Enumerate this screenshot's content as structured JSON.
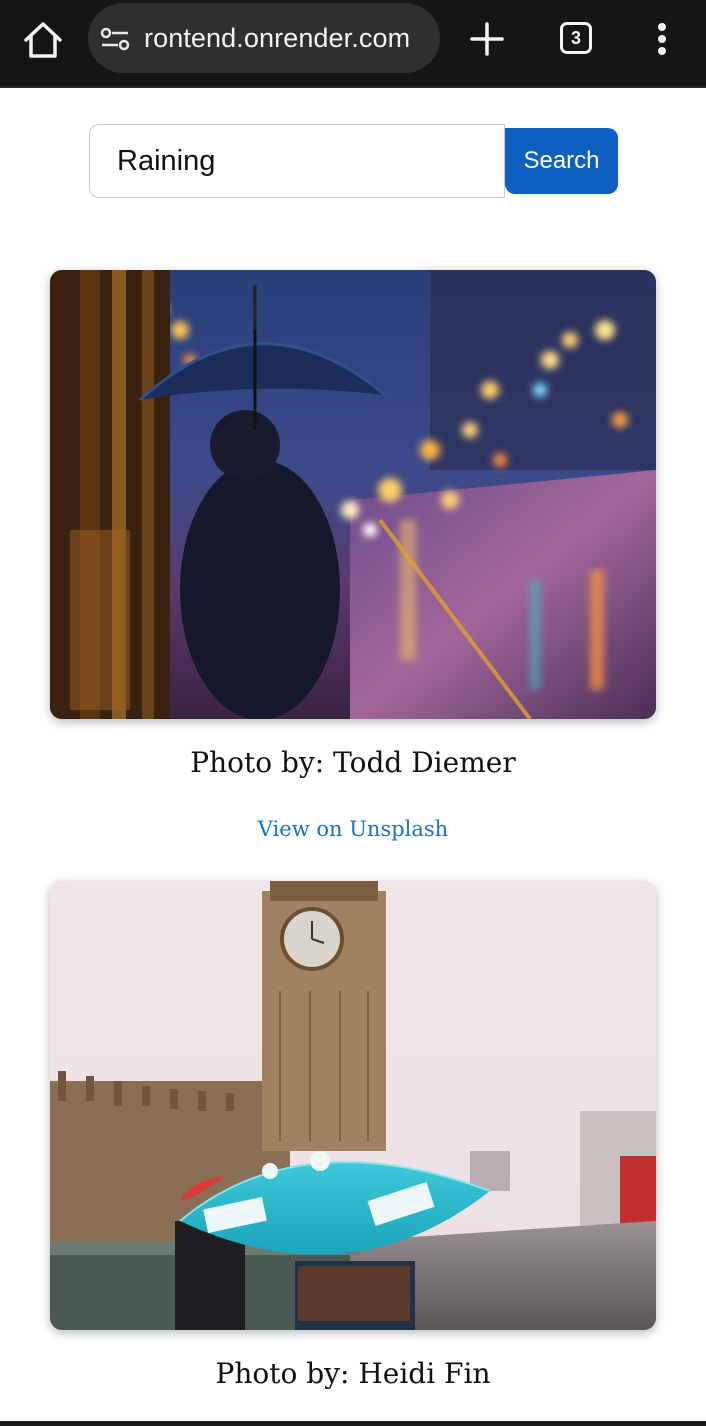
{
  "browser": {
    "url": "rontend.onrender.com",
    "tab_count": "3",
    "icons": [
      "home-icon",
      "tune-icon",
      "plus-icon",
      "tab-switcher-icon",
      "more-vert-icon"
    ]
  },
  "search": {
    "value": "Raining",
    "button_label": "Search",
    "accent": "#0d5fc0"
  },
  "results": [
    {
      "credit": "Photo by: Todd Diemer",
      "link_text": "View on Unsplash"
    },
    {
      "credit": "Photo by: Heidi Fin"
    }
  ],
  "colors": {
    "link": "#1a73c9",
    "chrome_bg": "#151515"
  }
}
